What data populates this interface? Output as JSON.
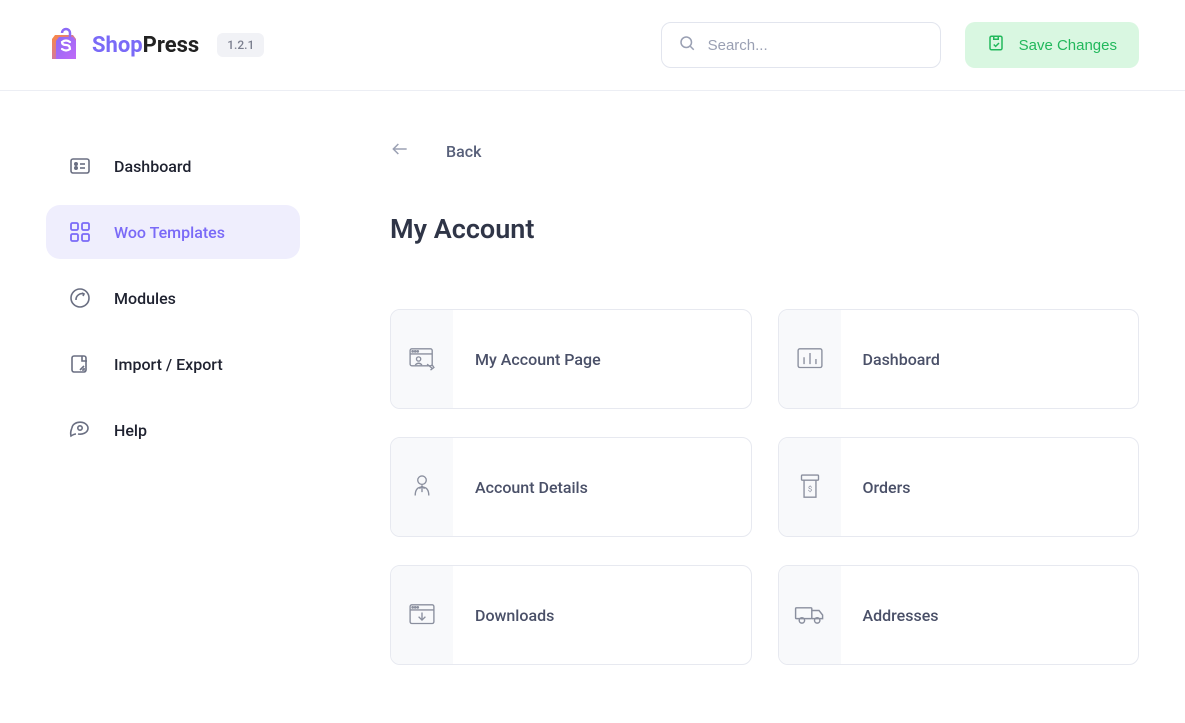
{
  "app": {
    "name_part1": "Shop",
    "name_part2": "Press",
    "version": "1.2.1"
  },
  "search": {
    "placeholder": "Search..."
  },
  "actions": {
    "save_label": "Save Changes"
  },
  "sidebar": {
    "items": [
      {
        "label": "Dashboard",
        "icon": "dashboard-icon",
        "active": false
      },
      {
        "label": "Woo Templates",
        "icon": "templates-icon",
        "active": true
      },
      {
        "label": "Modules",
        "icon": "modules-icon",
        "active": false
      },
      {
        "label": "Import / Export",
        "icon": "import-export-icon",
        "active": false
      },
      {
        "label": "Help",
        "icon": "help-icon",
        "active": false
      }
    ]
  },
  "back": {
    "label": "Back"
  },
  "page": {
    "title": "My Account"
  },
  "cards": [
    {
      "label": "My Account Page",
      "icon": "account-page-icon"
    },
    {
      "label": "Dashboard",
      "icon": "chart-icon"
    },
    {
      "label": "Account Details",
      "icon": "person-icon"
    },
    {
      "label": "Orders",
      "icon": "receipt-icon"
    },
    {
      "label": "Downloads",
      "icon": "download-window-icon"
    },
    {
      "label": "Addresses",
      "icon": "truck-icon"
    }
  ]
}
